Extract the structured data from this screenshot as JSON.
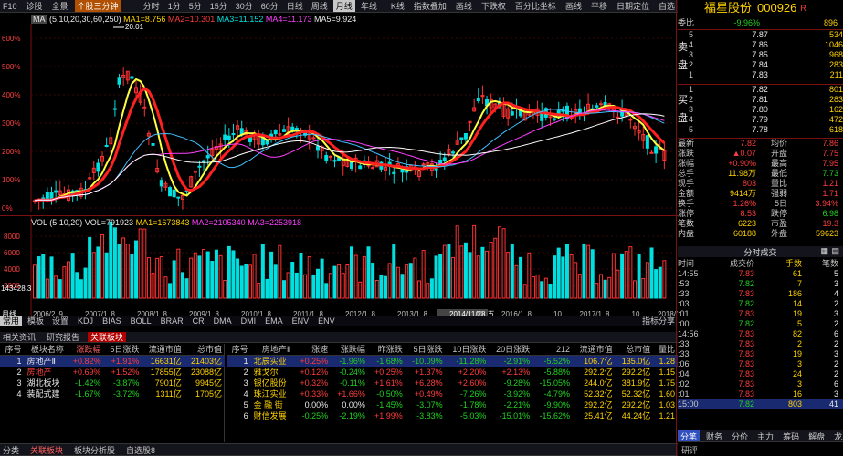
{
  "toolbar": {
    "f10": "F10",
    "diagnose": "诊股",
    "all": "全景",
    "sel_stock": "个股三分钟",
    "periods": [
      "分时",
      "1分",
      "5分",
      "15分",
      "30分",
      "60分",
      "日线",
      "周线",
      "月线",
      "年线"
    ],
    "tools": [
      "K线",
      "指数叠加",
      "画线",
      "下跌权",
      "百分比坐标",
      "画线",
      "平移",
      "日期定位",
      "自选"
    ]
  },
  "chart": {
    "ma_label": "MA",
    "ma_params": "(5,10,20,30,60,250)",
    "ma1": "MA1=8.756",
    "ma2": "MA2=10.301",
    "ma3": "MA3=11.152",
    "ma4": "MA4=11.173",
    "ma5": "MA5=9.924",
    "high_label": "20.01",
    "price_ticks": [
      "600%",
      "500%",
      "400%",
      "300%",
      "200%",
      "100%",
      "0%"
    ],
    "vol_title": "VOL",
    "vol_params": "(5,10,20)",
    "vol_val": "VOL=791923",
    "vol_ma1": "MA1=1673843",
    "vol_ma2": "MA2=2105340",
    "vol_ma3": "MA3=2253918",
    "vol_ticks": [
      "8000",
      "6000",
      "4000",
      "2000"
    ],
    "vol_cursor": "143428.3",
    "date_ticks": [
      "2006/2",
      "9",
      "2007/1",
      "8",
      "2008/1",
      "8",
      "2009/1",
      "8",
      "2010/1",
      "8",
      "2011/1",
      "8",
      "2012/1",
      "8",
      "2013/1",
      "8",
      "2014/11/28,五",
      "10",
      "2016/1",
      "8",
      "10",
      "2017/1",
      "8",
      "10",
      "2018/1"
    ],
    "cursor_date": "2014/11/28,五",
    "period": "月线",
    "colors": {
      "up": "#ff3232",
      "down": "#00e0e0",
      "ma1": "#ffff40",
      "ma2": "#ff2020",
      "ma3": "#40c0ff",
      "ma4": "#ff40ff",
      "ma5": "#ffffff"
    }
  },
  "indicator_tabs": {
    "prefix": [
      "常用",
      "模板",
      "设置"
    ],
    "items": [
      "KDJ",
      "BIAS",
      "BOLL",
      "BRAR",
      "CR",
      "DMA",
      "DMI",
      "EMA",
      "ENV",
      "ENV"
    ],
    "right": "指标分享"
  },
  "bottom_tabs": [
    "相关资讯",
    "研究报告",
    "关联板块"
  ],
  "sector_table": {
    "headers": [
      "序号",
      "板块名称",
      "涨跌幅",
      "5日涨跌",
      "流通市值",
      "总市值"
    ],
    "rows": [
      {
        "no": "1",
        "name": "房地产Ⅱ",
        "chg": "+0.82%",
        "chg5": "+1.91%",
        "float": "16631亿",
        "total": "21403亿"
      },
      {
        "no": "2",
        "name": "房地产",
        "chg": "+0.69%",
        "chg5": "+1.52%",
        "float": "17855亿",
        "total": "23088亿"
      },
      {
        "no": "3",
        "name": "湖北板块",
        "chg": "-1.42%",
        "chg5": "-3.87%",
        "float": "7901亿",
        "total": "9945亿"
      },
      {
        "no": "4",
        "name": "装配式建",
        "chg": "-1.67%",
        "chg5": "-3.72%",
        "float": "1311亿",
        "total": "1705亿"
      }
    ]
  },
  "stock_table": {
    "headers": [
      "序号",
      "房地产Ⅱ",
      "涨速",
      "涨跌幅",
      "昨涨跌",
      "5日涨跌",
      "10日涨跌",
      "20日涨跌",
      "212",
      "流通市值",
      "总市值",
      "量比"
    ],
    "rows": [
      {
        "no": "1",
        "name": "北辰实业",
        "v": [
          "+0.25%",
          "-1.96%",
          "-1.68%",
          "-10.09%",
          "-11.28%",
          "-2.91%",
          "-5.52%",
          "106.7亿",
          "135.0亿",
          "1.28"
        ]
      },
      {
        "no": "2",
        "name": "雅戈尔",
        "v": [
          "+0.12%",
          "-0.24%",
          "+0.25%",
          "+1.37%",
          "+2.20%",
          "+2.13%",
          "-5.88%",
          "292.2亿",
          "292.2亿",
          "1.15"
        ]
      },
      {
        "no": "3",
        "name": "银亿股份",
        "v": [
          "+0.32%",
          "-0.11%",
          "+1.61%",
          "+6.28%",
          "+2.60%",
          "-9.28%",
          "-15.05%",
          "244.0亿",
          "381.9亿",
          "1.75"
        ]
      },
      {
        "no": "4",
        "name": "珠江实业",
        "v": [
          "+0.33%",
          "+1.66%",
          "-0.50%",
          "+0.49%",
          "-7.26%",
          "-3.92%",
          "-4.79%",
          "52.32亿",
          "52.32亿",
          "1.60"
        ]
      },
      {
        "no": "5",
        "name": "金 融 街",
        "v": [
          "0.00%",
          "0.00%",
          "-1.45%",
          "-3.07%",
          "-1.78%",
          "-2.21%",
          "-9.90%",
          "292.2亿",
          "292.2亿",
          "1.03"
        ]
      },
      {
        "no": "6",
        "name": "财信发展",
        "v": [
          "-0.25%",
          "-2.19%",
          "+1.99%",
          "-3.83%",
          "-5.03%",
          "-15.01%",
          "-15.62%",
          "25.41亿",
          "44.24亿",
          "1.21"
        ]
      }
    ]
  },
  "footer_tabs": [
    "分类",
    "关联板块",
    "板块分析股",
    "自选股8"
  ],
  "stock": {
    "name": "福星股份",
    "code": "000926",
    "badge": "R"
  },
  "orderbook": {
    "weibi_label": "委比",
    "weibi": "-9.96%",
    "weicha": "896",
    "sell_label": "卖盘",
    "buy_label": "买盘",
    "sell": [
      {
        "lv": "5",
        "p": "7.87",
        "v": "534"
      },
      {
        "lv": "4",
        "p": "7.86",
        "v": "1046"
      },
      {
        "lv": "3",
        "p": "7.85",
        "v": "968"
      },
      {
        "lv": "2",
        "p": "7.84",
        "v": "283"
      },
      {
        "lv": "1",
        "p": "7.83",
        "v": "211"
      }
    ],
    "buy": [
      {
        "lv": "1",
        "p": "7.82",
        "v": "801"
      },
      {
        "lv": "2",
        "p": "7.81",
        "v": "283"
      },
      {
        "lv": "3",
        "p": "7.80",
        "v": "162"
      },
      {
        "lv": "4",
        "p": "7.79",
        "v": "472"
      },
      {
        "lv": "5",
        "p": "7.78",
        "v": "618"
      }
    ]
  },
  "stats": [
    [
      "最新",
      "7.82",
      "均价",
      "7.86"
    ],
    [
      "涨跌",
      "▲0.07",
      "开盘",
      "7.75"
    ],
    [
      "涨幅",
      "+0.90%",
      "最高",
      "7.95"
    ],
    [
      "总手",
      "11.98万",
      "最低",
      "7.73"
    ],
    [
      "现手",
      "803",
      "量比",
      "1.21"
    ],
    [
      "金额",
      "9414万",
      "强弱",
      "1.71"
    ],
    [
      "换手",
      "1.26%",
      "5日",
      "3.94%"
    ],
    [
      "涨停",
      "8.53",
      "跌停",
      "6.98"
    ],
    [
      "笔数",
      "6223",
      "市盈",
      "19.3"
    ],
    [
      "内盘",
      "60188",
      "外盘",
      "59623"
    ]
  ],
  "trades_title": "分时成交",
  "trades_headers": [
    "时间",
    "成交价",
    "手数",
    "笔数"
  ],
  "trades": [
    [
      "14:55",
      "7.83",
      "61",
      "5"
    ],
    [
      ":53",
      "7.82",
      "7",
      "3"
    ],
    [
      ":33",
      "7.83",
      "186",
      "4"
    ],
    [
      ":03",
      "7.82",
      "14",
      "2"
    ],
    [
      ":01",
      "7.83",
      "19",
      "3"
    ],
    [
      ":00",
      "7.82",
      "5",
      "2"
    ],
    [
      "14:56",
      "7.83",
      "82",
      "6"
    ],
    [
      ":33",
      "7.83",
      "2",
      "2"
    ],
    [
      ":33",
      "7.83",
      "19",
      "3"
    ],
    [
      ":06",
      "7.83",
      "3",
      "2"
    ],
    [
      ":04",
      "7.83",
      "24",
      "2"
    ],
    [
      ":02",
      "7.83",
      "3",
      "6"
    ],
    [
      ":01",
      "7.83",
      "16",
      "3"
    ],
    [
      "15:00",
      "7.82",
      "803",
      "41"
    ]
  ],
  "right_tabs": [
    "分笔",
    "财务",
    "分价",
    "主力",
    "筹码",
    "解盘",
    "龙虎"
  ],
  "right_footer": "研评"
}
